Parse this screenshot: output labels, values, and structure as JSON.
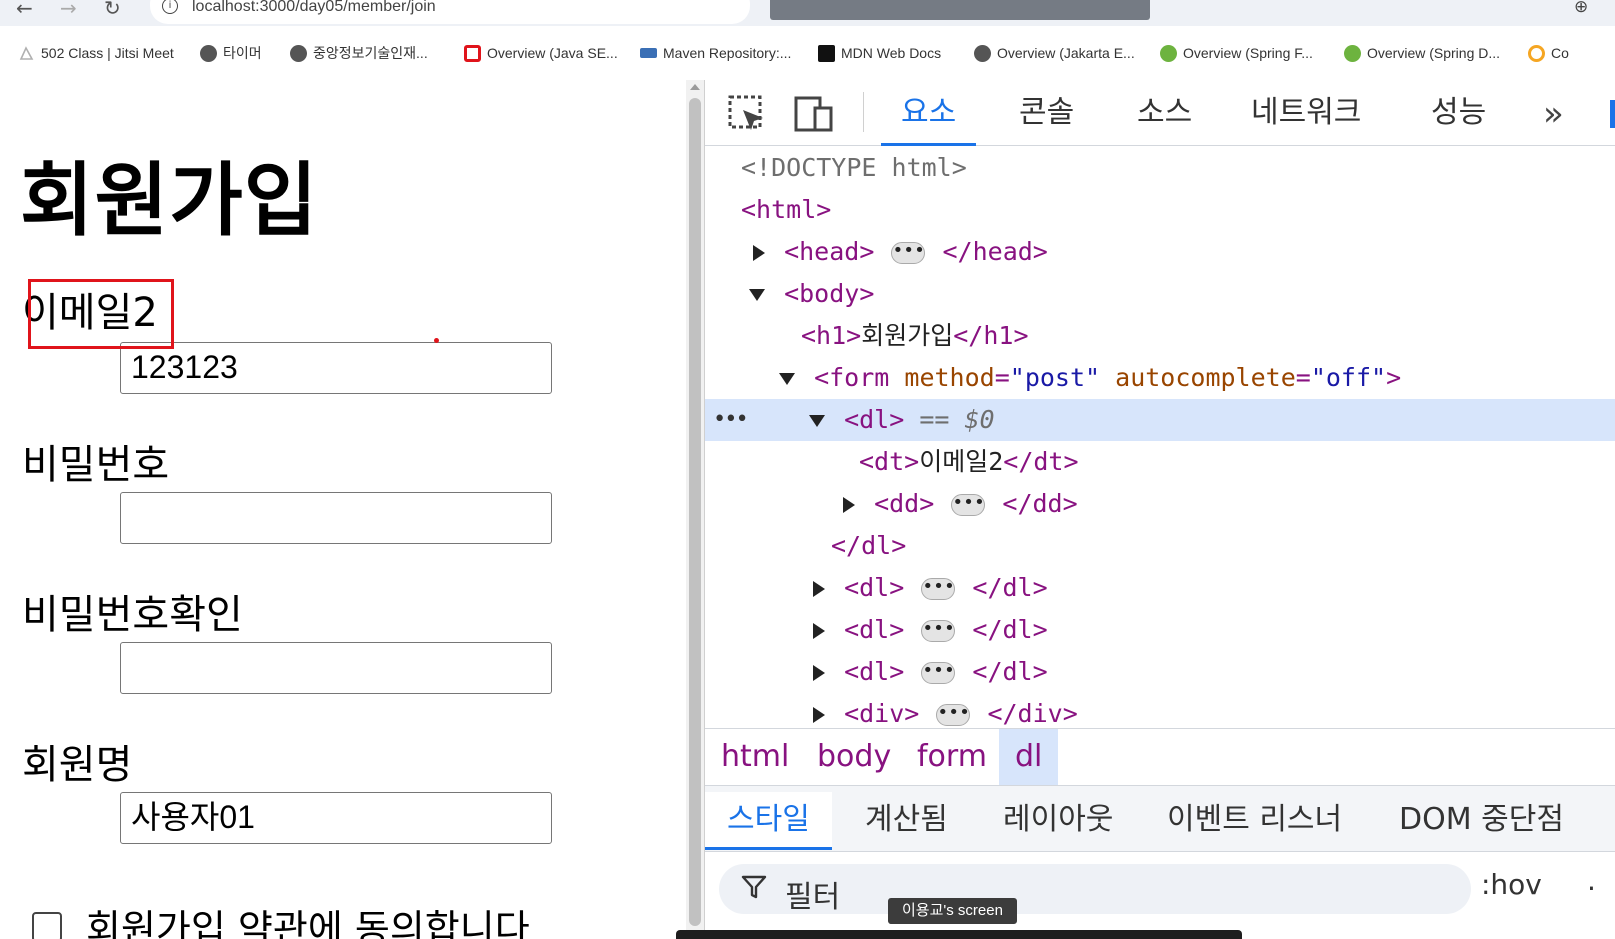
{
  "browser": {
    "url": "localhost:3000/day05/member/join",
    "bookmarks": [
      {
        "label": "502 Class | Jitsi Meet",
        "icon": "jitsi-icon",
        "color": "#b0b0b0"
      },
      {
        "label": "타이머",
        "icon": "globe-icon",
        "color": "#555555"
      },
      {
        "label": "중앙정보기술인재...",
        "icon": "globe-icon",
        "color": "#555555"
      },
      {
        "label": "Overview (Java SE...",
        "icon": "oracle-icon",
        "color": "#e0141b"
      },
      {
        "label": "Maven Repository:...",
        "icon": "mvn-icon",
        "color": "#3a6fb5"
      },
      {
        "label": "MDN Web Docs",
        "icon": "mdn-icon",
        "color": "#111111"
      },
      {
        "label": "Overview (Jakarta E...",
        "icon": "globe-icon",
        "color": "#555555"
      },
      {
        "label": "Overview (Spring F...",
        "icon": "spring-icon",
        "color": "#6db33f"
      },
      {
        "label": "Overview (Spring D...",
        "icon": "spring-icon",
        "color": "#6db33f"
      },
      {
        "label": "Co",
        "icon": "co-icon",
        "color": "#f5a623"
      }
    ]
  },
  "page": {
    "title": "회원가입",
    "fields": [
      {
        "label": "이메일2",
        "value": "123123",
        "type": "text"
      },
      {
        "label": "비밀번호",
        "value": "",
        "type": "password"
      },
      {
        "label": "비밀번호확인",
        "value": "",
        "type": "password"
      },
      {
        "label": "회원명",
        "value": "사용자01",
        "type": "text"
      }
    ],
    "agree_label": "회원가입 약관에 동의합니다"
  },
  "devtools": {
    "tabs": [
      {
        "label": "요소",
        "active": true
      },
      {
        "label": "콘솔",
        "active": false
      },
      {
        "label": "소스",
        "active": false
      },
      {
        "label": "네트워크",
        "active": false
      },
      {
        "label": "성능",
        "active": false
      }
    ],
    "more_label": "»",
    "dom": {
      "doctype": "<!DOCTYPE html>",
      "html_open": "<html>",
      "head_open": "<head>",
      "head_close": "</head>",
      "body_open": "<body>",
      "h1_open": "<h1>",
      "h1_text": "회원가입",
      "h1_close": "</h1>",
      "form_tag": "<form",
      "form_attr1": "method",
      "form_val1": "\"post\"",
      "form_attr2": "autocomplete",
      "form_val2": "\"off\"",
      "form_end": ">",
      "dl_open": "<dl>",
      "dl_marker": "== $0",
      "dt_open": "<dt>",
      "dt_text": "이메일2",
      "dt_close": "</dt>",
      "dd_open": "<dd>",
      "dd_close": "</dd>",
      "dl_close": "</dl>",
      "div_open": "<div>",
      "div_close": "</div>",
      "ellipsis": "•••",
      "gutter_dots": "•••"
    },
    "breadcrumbs": [
      {
        "label": "html",
        "active": false
      },
      {
        "label": "body",
        "active": false
      },
      {
        "label": "form",
        "active": false
      },
      {
        "label": "dl",
        "active": true
      }
    ],
    "style_tabs": [
      {
        "label": "스타일",
        "active": true
      },
      {
        "label": "계산됨",
        "active": false
      },
      {
        "label": "레이아웃",
        "active": false
      },
      {
        "label": "이벤트 리스너",
        "active": false
      },
      {
        "label": "DOM 중단점",
        "active": false
      }
    ],
    "filter_placeholder": "필터",
    "hov_label": ":hov",
    "dim_more": "."
  },
  "screen_share_tag": "이용교's screen",
  "colors": {
    "highlight_red": "#e0141b",
    "devtools_accent": "#1a73e8",
    "selected_row": "#d7e5fb",
    "tag_color": "#881280"
  }
}
